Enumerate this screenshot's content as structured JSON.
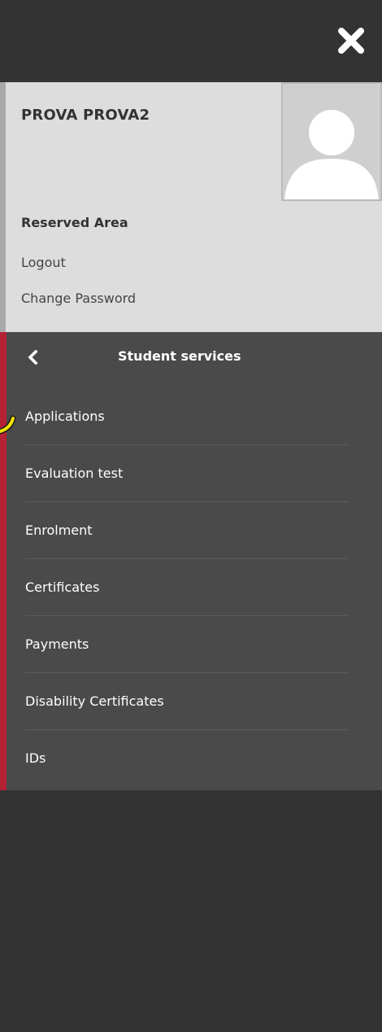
{
  "header": {
    "close_icon": "close-x-icon"
  },
  "user": {
    "name": "PROVA PROVA2",
    "avatar_icon": "user-avatar-icon",
    "reserved_area_title": "Reserved Area",
    "links": {
      "logout": "Logout",
      "change_password": "Change Password"
    }
  },
  "services": {
    "back_icon": "chevron-left-icon",
    "title": "Student services",
    "items": [
      {
        "label": "Applications"
      },
      {
        "label": "Evaluation test"
      },
      {
        "label": "Enrolment"
      },
      {
        "label": "Certificates"
      },
      {
        "label": "Payments"
      },
      {
        "label": "Disability Certificates"
      },
      {
        "label": "IDs"
      }
    ]
  },
  "colors": {
    "top_bar": "#333333",
    "user_panel_bg": "#dddddd",
    "services_bg": "#4a4a4a",
    "accent_red": "#b52233",
    "pointer_yellow": "#f5e400"
  }
}
